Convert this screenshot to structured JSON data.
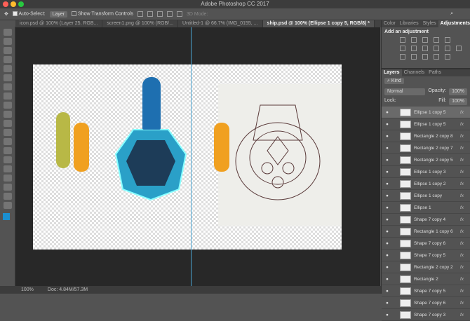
{
  "app": {
    "title": "Adobe Photoshop CC 2017"
  },
  "options": {
    "auto_select_label": "Auto-Select:",
    "auto_select_value": "Layer",
    "transform_label": "Show Transform Controls",
    "mode_3d": "3D Mode:"
  },
  "tabs": [
    {
      "label": "icon.psd @ 100% (Layer 25, RGB..."
    },
    {
      "label": "screen1.png @ 100% (RGB/..."
    },
    {
      "label": "Untitled-1 @ 66.7% (IMG_0155, ..."
    },
    {
      "label": "ship.psd @ 100% (Ellipse 1 copy 5, RGB/8) *"
    }
  ],
  "status": {
    "zoom": "100%",
    "doc": "Doc: 4.84M/57.3M"
  },
  "panel": {
    "top_tabs": [
      "Color",
      "Libraries",
      "Styles",
      "Adjustments"
    ],
    "adjust_title": "Add an adjustment",
    "layer_tabs": [
      "Layers",
      "Channels",
      "Paths"
    ],
    "filter": "Kind",
    "blend": "Normal",
    "opacity_label": "Opacity:",
    "opacity": "100%",
    "lock_label": "Lock:",
    "fill_label": "Fill:",
    "fill": "100%",
    "layers": [
      {
        "name": "Ellipse 1 copy 5"
      },
      {
        "name": "Ellipse 1 copy 5"
      },
      {
        "name": "Rectangle 2 copy 8"
      },
      {
        "name": "Rectangle 2 copy 7"
      },
      {
        "name": "Rectangle 2 copy 5"
      },
      {
        "name": "Ellipse 1 copy 3"
      },
      {
        "name": "Ellipse 1 copy 2"
      },
      {
        "name": "Ellipse 1 copy"
      },
      {
        "name": "Ellipse 1"
      },
      {
        "name": "Shape 7 copy 4"
      },
      {
        "name": "Rectangle 1 copy 6"
      },
      {
        "name": "Shape 7 copy 6"
      },
      {
        "name": "Shape 7 copy 5"
      },
      {
        "name": "Rectangle 2 copy 2"
      },
      {
        "name": "Rectangle 2"
      },
      {
        "name": "Shape 7 copy 5"
      },
      {
        "name": "Shape 7 copy 6"
      },
      {
        "name": "Shape 7 copy 3"
      }
    ]
  }
}
